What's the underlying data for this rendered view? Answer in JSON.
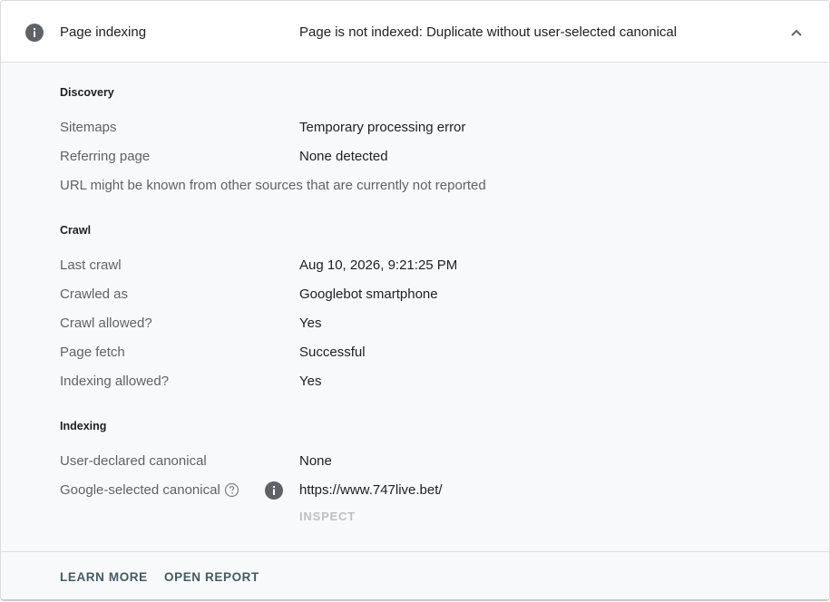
{
  "header": {
    "title": "Page indexing",
    "status": "Page is not indexed: Duplicate without user-selected canonical",
    "icon": "info-icon",
    "collapse_icon": "chevron-up-icon"
  },
  "discovery": {
    "title": "Discovery",
    "rows": [
      {
        "label": "Sitemaps",
        "value": "Temporary processing error"
      },
      {
        "label": "Referring page",
        "value": "None detected"
      }
    ],
    "note": "URL might be known from other sources that are currently not reported"
  },
  "crawl": {
    "title": "Crawl",
    "rows": [
      {
        "label": "Last crawl",
        "value": "Aug 10, 2026, 9:21:25 PM"
      },
      {
        "label": "Crawled as",
        "value": "Googlebot smartphone"
      },
      {
        "label": "Crawl allowed?",
        "value": "Yes"
      },
      {
        "label": "Page fetch",
        "value": "Successful"
      },
      {
        "label": "Indexing allowed?",
        "value": "Yes"
      }
    ]
  },
  "indexing": {
    "title": "Indexing",
    "rows": [
      {
        "label": "User-declared canonical",
        "value": "None"
      },
      {
        "label": "Google-selected canonical",
        "value": "https://www.747live.bet/"
      }
    ],
    "inspect_label": "INSPECT"
  },
  "footer": {
    "learn_more": "LEARN MORE",
    "open_report": "OPEN REPORT"
  },
  "colors": {
    "icon_gray": "#5f6368",
    "label_gray": "#5f6368",
    "link_slate": "#455a64",
    "disabled": "#bdc1c6"
  }
}
